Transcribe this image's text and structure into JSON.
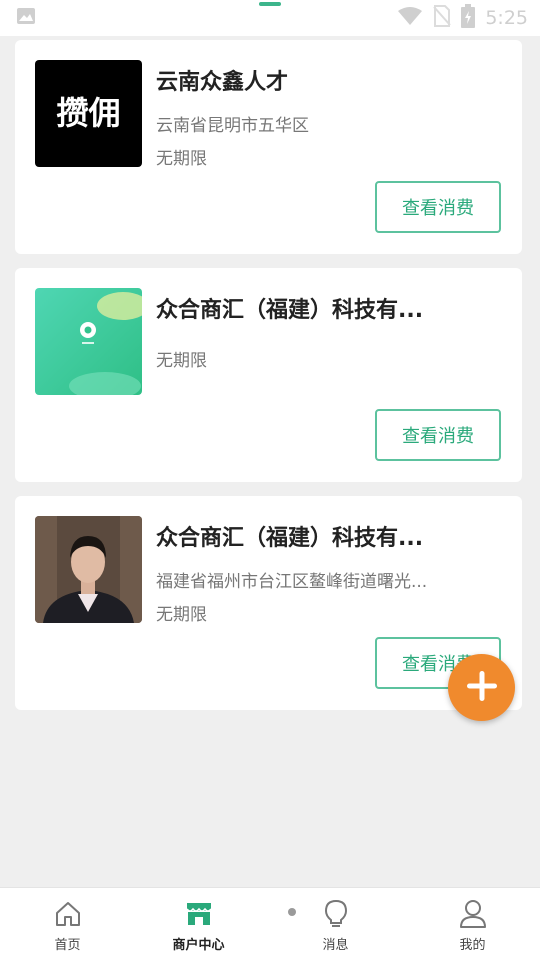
{
  "status_bar": {
    "time": "5:25"
  },
  "cards": [
    {
      "title": "云南众鑫人才",
      "address": "云南省昆明市五华区",
      "validity": "无期限",
      "button_label": "查看消费",
      "thumb_text": "攒佣"
    },
    {
      "title": "众合商汇（福建）科技有...",
      "address": "",
      "validity": "无期限",
      "button_label": "查看消费"
    },
    {
      "title": "众合商汇（福建）科技有...",
      "address": "福建省福州市台江区鳌峰街道曙光...",
      "validity": "无期限",
      "button_label": "查看消费"
    }
  ],
  "bottom_nav": {
    "items": [
      {
        "label": "首页",
        "icon": "home-icon"
      },
      {
        "label": "商户中心",
        "icon": "store-icon",
        "active": true
      },
      {
        "label": "消息",
        "icon": "lightbulb-icon"
      },
      {
        "label": "我的",
        "icon": "user-icon"
      }
    ]
  },
  "colors": {
    "accent": "#2aa97b",
    "fab": "#f08a2d",
    "background": "#efefef"
  }
}
